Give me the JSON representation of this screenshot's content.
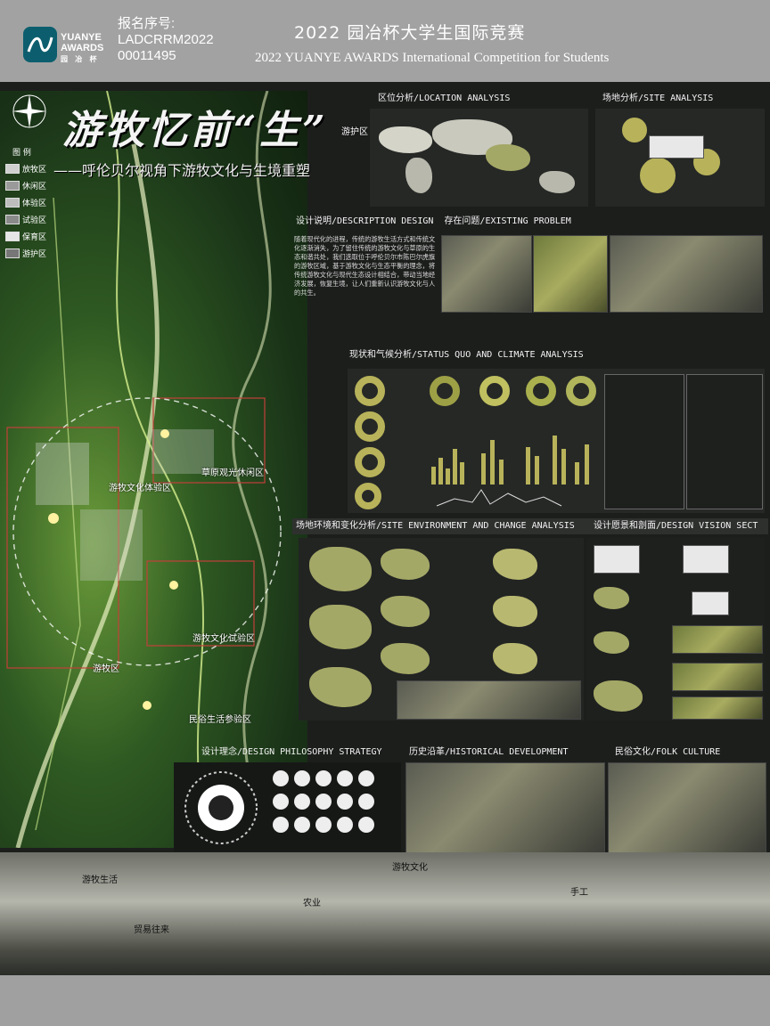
{
  "header": {
    "logo_line1": "YUANYE",
    "logo_line2": "AWARDS",
    "logo_line3": "园 冶 杯",
    "reg_label": "报名序号:",
    "reg_code": "LADCRRM2022",
    "reg_number": "00011495",
    "title_cn": "2022 园冶杯大学生国际竞赛",
    "title_en": "2022 YUANYE AWARDS International Competition for  Students"
  },
  "poster": {
    "main_title": "游牧忆前“生”",
    "subtitle": "——呼伦贝尔视角下游牧文化与生境重塑",
    "legend": {
      "title": "图 例",
      "items": [
        {
          "label": "放牧区",
          "color": "#cfcfcf"
        },
        {
          "label": "休闲区",
          "color": "#9a9a9a"
        },
        {
          "label": "体验区",
          "color": "#bdbdbd"
        },
        {
          "label": "试验区",
          "color": "#8a8a8a"
        },
        {
          "label": "保育区",
          "color": "#e6e6e6"
        },
        {
          "label": "游护区",
          "color": "#777777"
        }
      ]
    },
    "map_labels": {
      "protect": "游护区",
      "grassland": "草原观光休闲区",
      "nomad_exp": "游牧文化体验区",
      "nomad_trial": "游牧文化试验区",
      "grazing": "游牧区",
      "folk": "民俗生活参验区"
    },
    "sections": {
      "location": "区位分析/LOCATION ANALYSIS",
      "site": "场地分析/SITE ANALYSIS",
      "design_desc": "设计说明/DESCRIPTION DESIGN",
      "problem": "存在问题/EXISTING PROBLEM",
      "status": "现状和气候分析/STATUS QUO AND CLIMATE ANALYSIS",
      "environment": "场地环境和变化分析/SITE ENVIRONMENT AND CHANGE ANALYSIS",
      "vision": "设计愿景和剖面/DESIGN VISION SECT",
      "philosophy": "设计理念/DESIGN PHILOSOPHY STRATEGY",
      "history": "历史沿革/HISTORICAL DEVELOPMENT",
      "folk": "民俗文化/FOLK CULTURE"
    },
    "description_text": "随着现代化的进程，传统的游牧生活方式和传统文化逐渐消失，为了留住传统的游牧文化与草原的生态和谐共处，我们选取位于呼伦贝尔市陈巴尔虎旗的游牧区域，基于游牧文化与生态平衡的理念，将传统游牧文化与现代生态设计相结合，带动当地经济发展，恢复生境，让人们重新认识游牧文化与人的共生。",
    "strip_labels": {
      "nomad_culture": "游牧文化",
      "grazing_life": "游牧生活",
      "trade": "贸易往来",
      "farming": "农业",
      "craft": "手工"
    }
  }
}
